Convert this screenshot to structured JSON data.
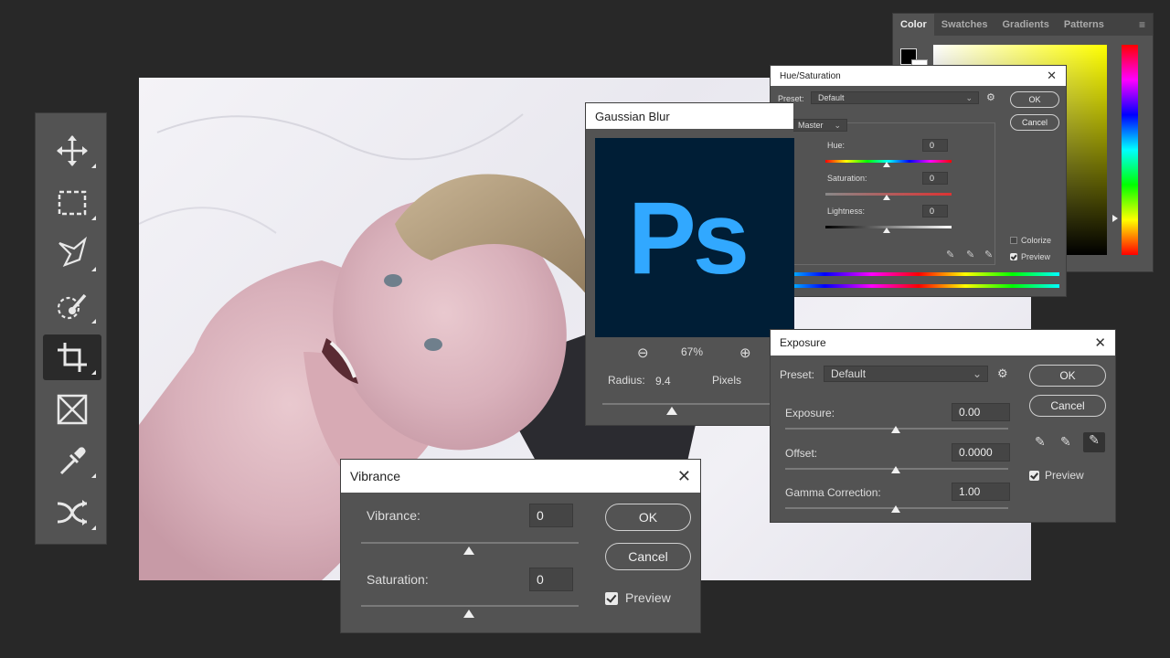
{
  "toolbar": {
    "tools": [
      {
        "name": "move-tool",
        "icon": "move-icon"
      },
      {
        "name": "marquee-tool",
        "icon": "marquee-icon"
      },
      {
        "name": "lasso-tool",
        "icon": "polygonal-lasso-icon"
      },
      {
        "name": "quick-selection-tool",
        "icon": "quick-selection-icon"
      },
      {
        "name": "crop-tool",
        "icon": "crop-icon",
        "active": true
      },
      {
        "name": "frame-tool",
        "icon": "frame-icon"
      },
      {
        "name": "eyedropper-tool",
        "icon": "eyedropper-icon"
      },
      {
        "name": "healing-tool",
        "icon": "patch-icon"
      }
    ]
  },
  "color_panel": {
    "tabs": [
      "Color",
      "Swatches",
      "Gradients",
      "Patterns"
    ],
    "active_tab": "Color",
    "foreground": "#000000",
    "background": "#ffffff"
  },
  "hue_saturation": {
    "title": "Hue/Saturation",
    "preset_label": "Preset:",
    "preset_value": "Default",
    "ok": "OK",
    "cancel": "Cancel",
    "channel": "Master",
    "hue_label": "Hue:",
    "hue_value": "0",
    "saturation_label": "Saturation:",
    "saturation_value": "0",
    "lightness_label": "Lightness:",
    "lightness_value": "0",
    "colorize_label": "Colorize",
    "preview_label": "Preview"
  },
  "gaussian_blur": {
    "title": "Gaussian Blur",
    "logo_text": "Ps",
    "zoom": "67%",
    "radius_label": "Radius:",
    "radius_value": "9.4",
    "radius_unit": "Pixels"
  },
  "exposure": {
    "title": "Exposure",
    "preset_label": "Preset:",
    "preset_value": "Default",
    "ok": "OK",
    "cancel": "Cancel",
    "exposure_label": "Exposure:",
    "exposure_value": "0.00",
    "offset_label": "Offset:",
    "offset_value": "0.0000",
    "gamma_label": "Gamma Correction:",
    "gamma_value": "1.00",
    "preview_label": "Preview"
  },
  "vibrance": {
    "title": "Vibrance",
    "vibrance_label": "Vibrance:",
    "vibrance_value": "0",
    "saturation_label": "Saturation:",
    "saturation_value": "0",
    "ok": "OK",
    "cancel": "Cancel",
    "preview_label": "Preview"
  }
}
